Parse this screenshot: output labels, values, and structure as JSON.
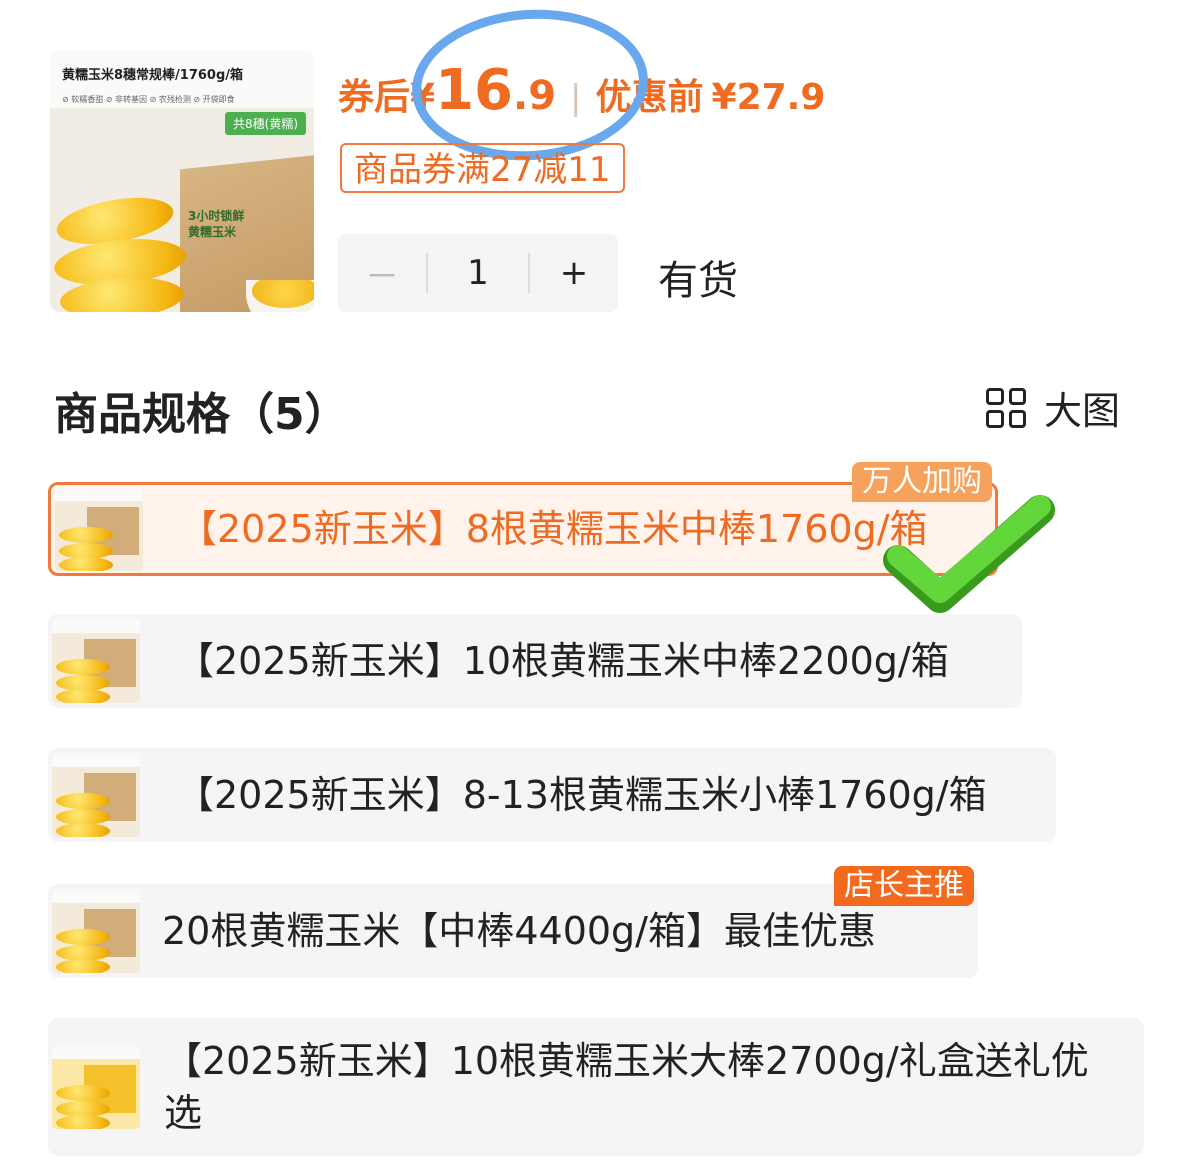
{
  "product": {
    "thumb_title": "黄糯玉米8穗常规棒/1760g/箱",
    "thumb_tags": "⊘ 软糯香甜   ⊘ 非转基因   ⊘ 农残检测   ⊘ 开袋即食",
    "thumb_badge": "共8穗(黄糯)",
    "thumb_box_label": "3小时锁鲜\n黄糯玉米",
    "price_prefix": "券后",
    "price_symbol": "¥",
    "price_integer": "16",
    "price_decimal": ".9",
    "price_before_label": "优惠前",
    "price_before": "¥27.9",
    "coupon": "商品券满27减11",
    "quantity": "1",
    "minus": "－",
    "plus": "+",
    "stock": "有货"
  },
  "specs": {
    "title": "商品规格（5）",
    "view_label": "大图",
    "items": [
      {
        "label": "【2025新玉米】8根黄糯玉米中棒1760g/箱",
        "badge": "万人加购",
        "selected": true
      },
      {
        "label": "【2025新玉米】10根黄糯玉米中棒2200g/箱"
      },
      {
        "label": "【2025新玉米】8-13根黄糯玉米小棒1760g/箱"
      },
      {
        "label": "20根黄糯玉米【中棒4400g/箱】最佳优惠",
        "badge": "店长主推"
      },
      {
        "label": "【2025新玉米】10根黄糯玉米大棒2700g/礼盒送礼优选"
      }
    ]
  },
  "colors": {
    "accent": "#ee6b21",
    "annotation_circle": "#6aa8ee",
    "annotation_check": "#4cc22a"
  },
  "icons": [
    "grid-icon",
    "checkmark-annotation"
  ]
}
